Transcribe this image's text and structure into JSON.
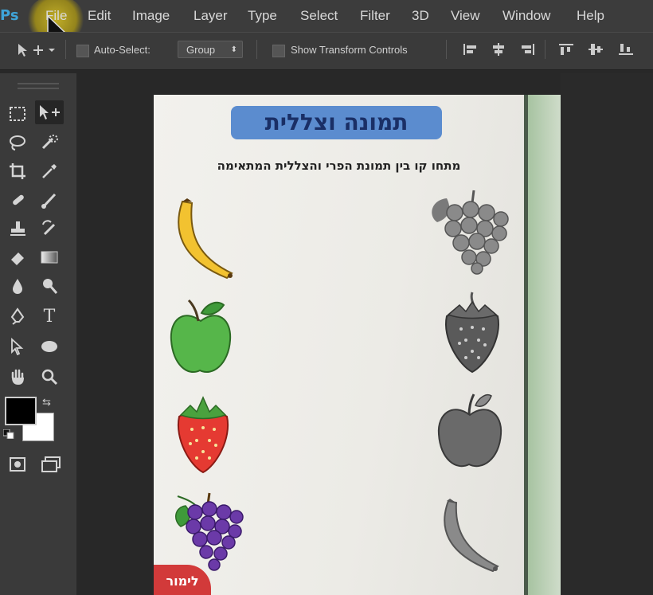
{
  "app": {
    "logo": "Ps"
  },
  "menu": {
    "items": [
      "File",
      "Edit",
      "Image",
      "Layer",
      "Type",
      "Select",
      "Filter",
      "3D",
      "View",
      "Window",
      "Help"
    ]
  },
  "options": {
    "auto_select_label": "Auto-Select:",
    "auto_select_value": "Group",
    "show_transform_label": "Show Transform Controls"
  },
  "document": {
    "title": "תמונה וצללית",
    "instruction": "מתחו קו בין תמונת הפרי והצללית המתאימה",
    "logo_text": "לימור",
    "left_fruits": [
      "banana",
      "apple",
      "strawberry",
      "grapes"
    ],
    "right_shadows": [
      "grapes",
      "strawberry",
      "apple",
      "banana"
    ]
  },
  "colors": {
    "foreground": "#000000",
    "background": "#ffffff",
    "title_bg": "#5b8ccf"
  }
}
